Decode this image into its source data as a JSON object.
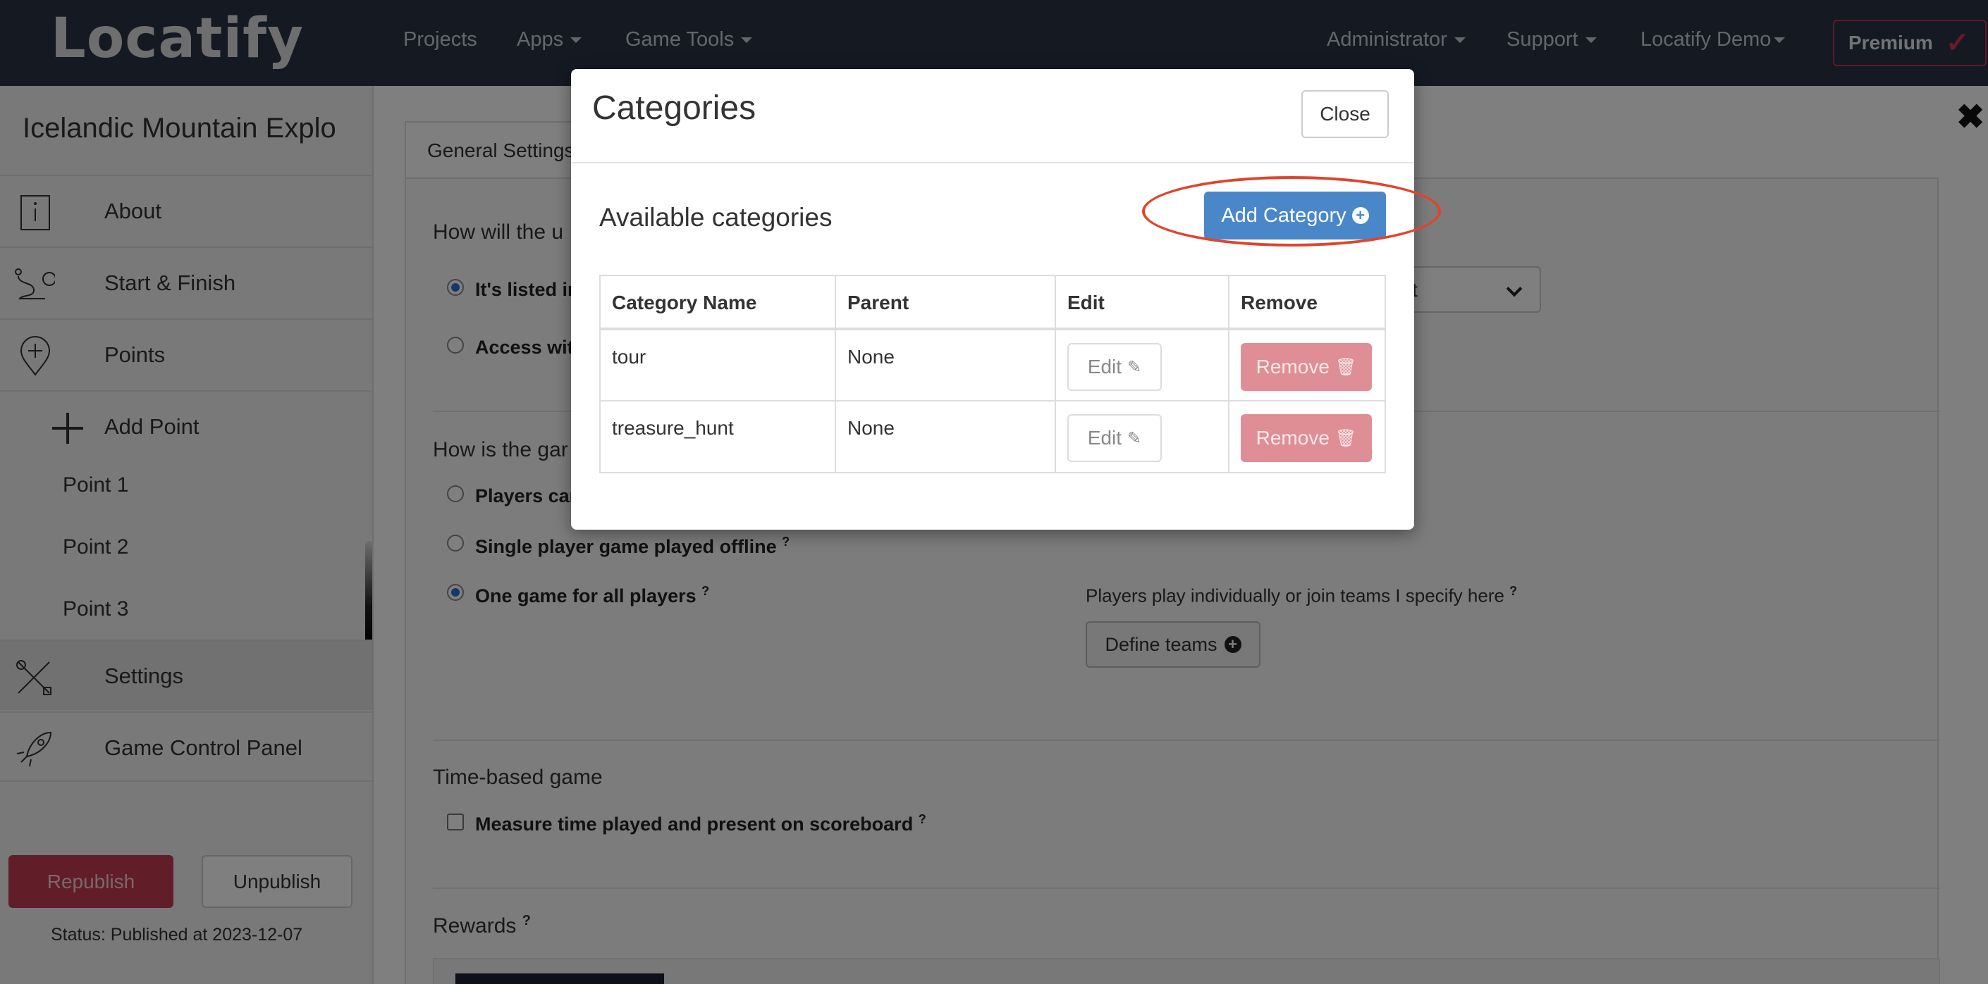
{
  "header": {
    "logo": "Locatify",
    "nav": [
      {
        "label": "Projects",
        "dropdown": false
      },
      {
        "label": "Apps",
        "dropdown": true
      },
      {
        "label": "Game Tools",
        "dropdown": true
      }
    ],
    "right_nav": [
      {
        "label": "Administrator",
        "dropdown": true
      },
      {
        "label": "Support",
        "dropdown": true
      },
      {
        "label": "Locatify Demo",
        "dropdown": true
      }
    ],
    "premium_label": "Premium"
  },
  "sidebar": {
    "game_title": "Icelandic Mountain Explo",
    "items": [
      {
        "label": "About",
        "icon": "info-icon"
      },
      {
        "label": "Start & Finish",
        "icon": "route-icon"
      },
      {
        "label": "Points",
        "icon": "map-pin-icon"
      },
      {
        "label": "Add Point",
        "icon": "plus-icon"
      },
      {
        "label": "Settings",
        "icon": "tools-icon"
      },
      {
        "label": "Game Control Panel",
        "icon": "rocket-icon"
      }
    ],
    "points": [
      "Point 1",
      "Point 2",
      "Point 3"
    ],
    "republish_label": "Republish",
    "unpublish_label": "Unpublish",
    "status": "Status: Published at 2023-12-07"
  },
  "main": {
    "tab_label": "General Settings",
    "q1": "How will the u",
    "opt_listed": "It's listed ir",
    "opt_access": "Access wit",
    "select_value": "unt",
    "q2": "How is the gar",
    "opt_players": "Players car",
    "opt_single": "Single player game played offline",
    "opt_one_game": "One game for all players",
    "teams_text": "Players play individually or join teams I specify here",
    "define_teams_label": "Define teams",
    "time_heading": "Time-based game",
    "time_checkbox": "Measure time played and present on scoreboard",
    "rewards_heading": "Rewards",
    "help_mark": "?"
  },
  "modal": {
    "title": "Categories",
    "close_label": "Close",
    "available_heading": "Available categories",
    "add_label": "Add Category",
    "columns": [
      "Category Name",
      "Parent",
      "Edit",
      "Remove"
    ],
    "rows": [
      {
        "name": "tour",
        "parent": "None"
      },
      {
        "name": "treasure_hunt",
        "parent": "None"
      }
    ],
    "edit_label": "Edit",
    "remove_label": "Remove"
  },
  "colors": {
    "topbar": "#2b3245",
    "accent_blue": "#4a87c9",
    "remove_red": "#e08e95",
    "republish": "#c23a51",
    "highlight": "#e0442b"
  }
}
